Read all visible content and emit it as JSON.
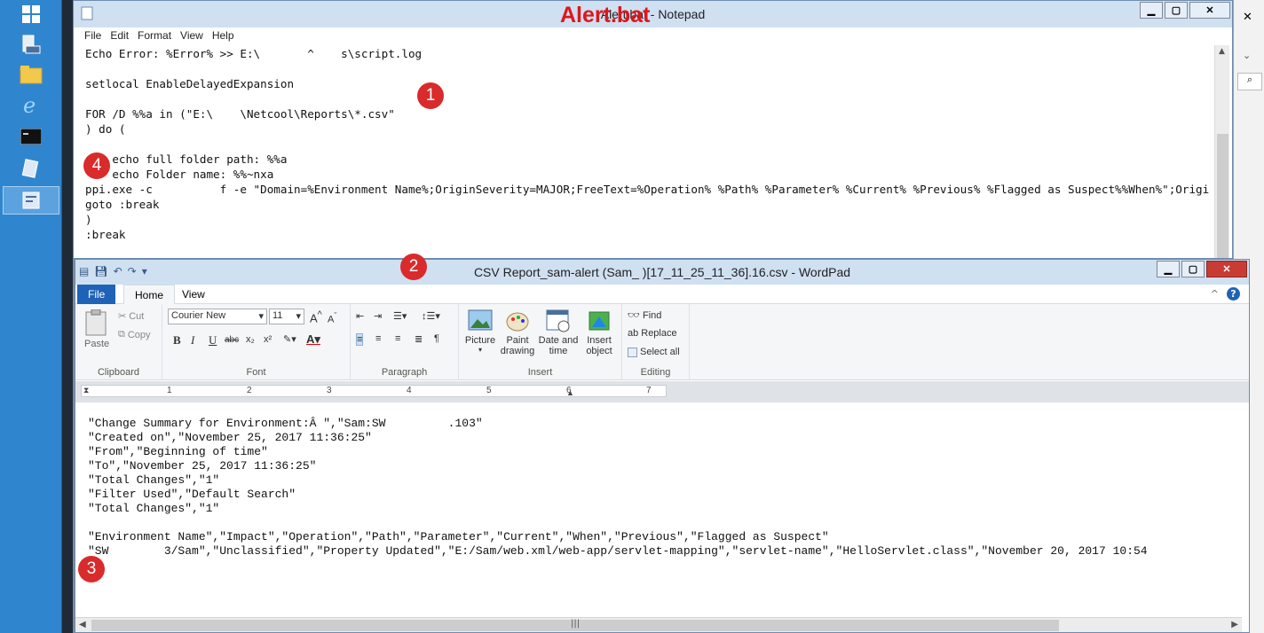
{
  "notepad": {
    "window_title": "Alert.bat - Notepad",
    "overlay_label": "Alert.bat",
    "menu": [
      "File",
      "Edit",
      "Format",
      "View",
      "Help"
    ],
    "lines": [
      "Echo Error: %Error% >> E:\\       ^    s\\script.log",
      "",
      "setlocal EnableDelayedExpansion",
      "",
      "FOR /D %%a in (\"E:\\    \\Netcool\\Reports\\*.csv\"",
      ") do (",
      "",
      "    echo full folder path: %%a",
      "    echo Folder name: %%~nxa",
      "ppi.exe -c          f -e \"Domain=%Environment Name%;OriginSeverity=MAJOR;FreeText=%Operation% %Path% %Parameter% %Current% %Previous% %Flagged as Suspect%%When%\";Origi",
      "goto :break",
      ")",
      ":break"
    ]
  },
  "wordpad": {
    "window_title": "CSV Report_sam-alert (Sam_         )[17_11_25_11_36].16.csv - WordPad",
    "tabs": {
      "file": "File",
      "home": "Home",
      "view": "View"
    },
    "clipboard": {
      "paste": "Paste",
      "cut": "Cut",
      "copy": "Copy",
      "label": "Clipboard"
    },
    "font": {
      "family": "Courier New",
      "size": "11",
      "label": "Font"
    },
    "paragraph": {
      "label": "Paragraph"
    },
    "insert": {
      "picture": "Picture",
      "paint": "Paint drawing",
      "datetime": "Date and time",
      "object": "Insert object",
      "label": "Insert"
    },
    "editing": {
      "find": "Find",
      "replace": "Replace",
      "select_all": "Select all",
      "label": "Editing"
    },
    "ruler_numbers": [
      "1",
      "2",
      "3",
      "4",
      "5",
      "6",
      "7"
    ],
    "lines": [
      "\"Change Summary for Environment:Â \",\"Sam:SW         .103\"",
      "\"Created on\",\"November 25, 2017 11:36:25\"",
      "\"From\",\"Beginning of time\"",
      "\"To\",\"November 25, 2017 11:36:25\"",
      "\"Total Changes\",\"1\"",
      "\"Filter Used\",\"Default Search\"",
      "\"Total Changes\",\"1\"",
      "",
      "\"Environment Name\",\"Impact\",\"Operation\",\"Path\",\"Parameter\",\"Current\",\"When\",\"Previous\",\"Flagged as Suspect\"",
      "\"SW        3/Sam\",\"Unclassified\",\"Property Updated\",\"E:/Sam/web.xml/web-app/servlet-mapping\",\"servlet-name\",\"HelloServlet.class\",\"November 20, 2017 10:54"
    ]
  },
  "callouts": [
    "1",
    "2",
    "3",
    "4"
  ]
}
